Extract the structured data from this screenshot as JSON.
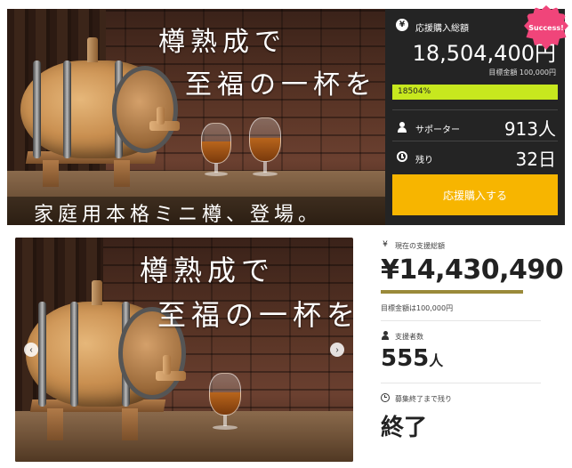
{
  "top": {
    "hero": {
      "title_line1": "樽熟成で",
      "title_line2": "至福の一杯を",
      "caption": "家庭用本格ミニ樽、登場。"
    },
    "panel": {
      "yen_icon": "¥",
      "total_label": "応援購入総額",
      "total_amount": "18,504,400円",
      "target": "目標金額 100,000円",
      "progress_text": "18504%",
      "progress_fraction": 1.0,
      "supporters_label": "サポーター",
      "supporters_value": "913人",
      "remaining_label": "残り",
      "remaining_value": "32日",
      "button_label": "応援購入する",
      "badge": "Success!",
      "accent_color": "#c7e81e",
      "button_color": "#f7b500",
      "badge_color": "#f0457a"
    }
  },
  "bottom": {
    "hero": {
      "title_line1": "樽熟成で",
      "title_line2": "至福の一杯を",
      "prev_icon": "‹",
      "next_icon": "›"
    },
    "stats": {
      "yen_icon": "¥",
      "total_label": "現在の支援総額",
      "total_amount": "¥14,430,490",
      "target": "目標金額は100,000円",
      "supporters_label": "支援者数",
      "supporters_value": "555",
      "supporters_unit": "人",
      "remaining_label": "募集終了まで残り",
      "remaining_value": "終了",
      "bar_color": "#9a8a3a"
    }
  }
}
